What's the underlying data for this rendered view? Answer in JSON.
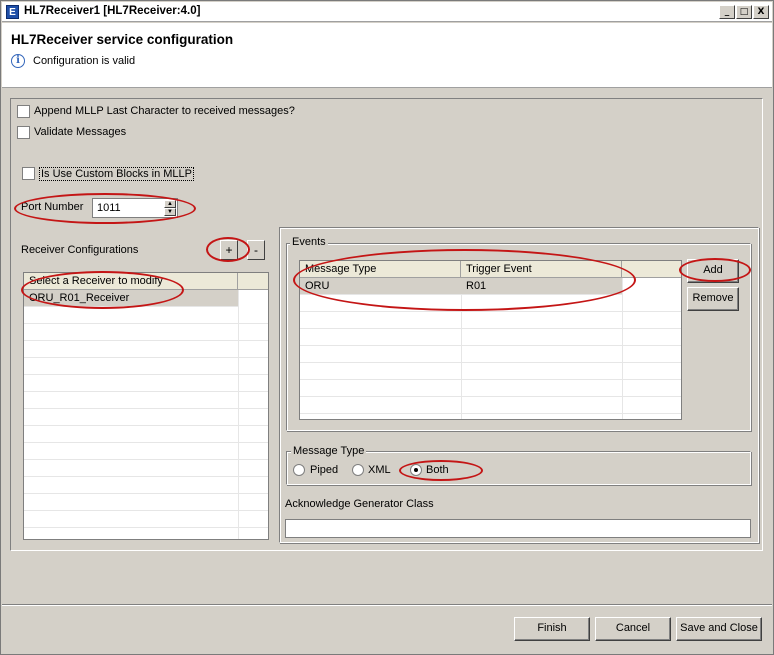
{
  "window": {
    "title": "HL7Receiver1 [HL7Receiver:4.0]",
    "app_icon_glyph": "E",
    "minimize_glyph": "_",
    "maximize_glyph": "□",
    "close_glyph": "X"
  },
  "header": {
    "title": "HL7Receiver service configuration",
    "status_icon_glyph": "i",
    "status": "Configuration is valid"
  },
  "options": {
    "append_mllp_label": "Append MLLP Last Character to received messages?",
    "append_mllp_checked": false,
    "validate_label": "Validate Messages",
    "validate_checked": false,
    "custom_blocks_label": "Is Use Custom Blocks in MLLP",
    "custom_blocks_checked": false
  },
  "port": {
    "label": "Port Number",
    "value": "1011",
    "up_glyph": "▲",
    "down_glyph": "▼"
  },
  "receivers": {
    "label": "Receiver Configurations",
    "add_glyph": "+",
    "remove_glyph": "-",
    "column": "Select a Receiver to modify",
    "rows": [
      "ORU_R01_Receiver"
    ]
  },
  "events": {
    "label": "Events",
    "columns": [
      "Message Type",
      "Trigger Event"
    ],
    "rows": [
      {
        "message_type": "ORU",
        "trigger_event": "R01"
      }
    ],
    "add_label": "Add",
    "remove_label": "Remove"
  },
  "message_type": {
    "label": "Message Type",
    "options": [
      "Piped",
      "XML",
      "Both"
    ],
    "selected": "Both"
  },
  "ack": {
    "label": "Acknowledge Generator Class",
    "value": ""
  },
  "footer": {
    "finish_label": "Finish",
    "cancel_label": "Cancel",
    "save_close_label": "Save and Close"
  },
  "annotation_color": "#c41515"
}
